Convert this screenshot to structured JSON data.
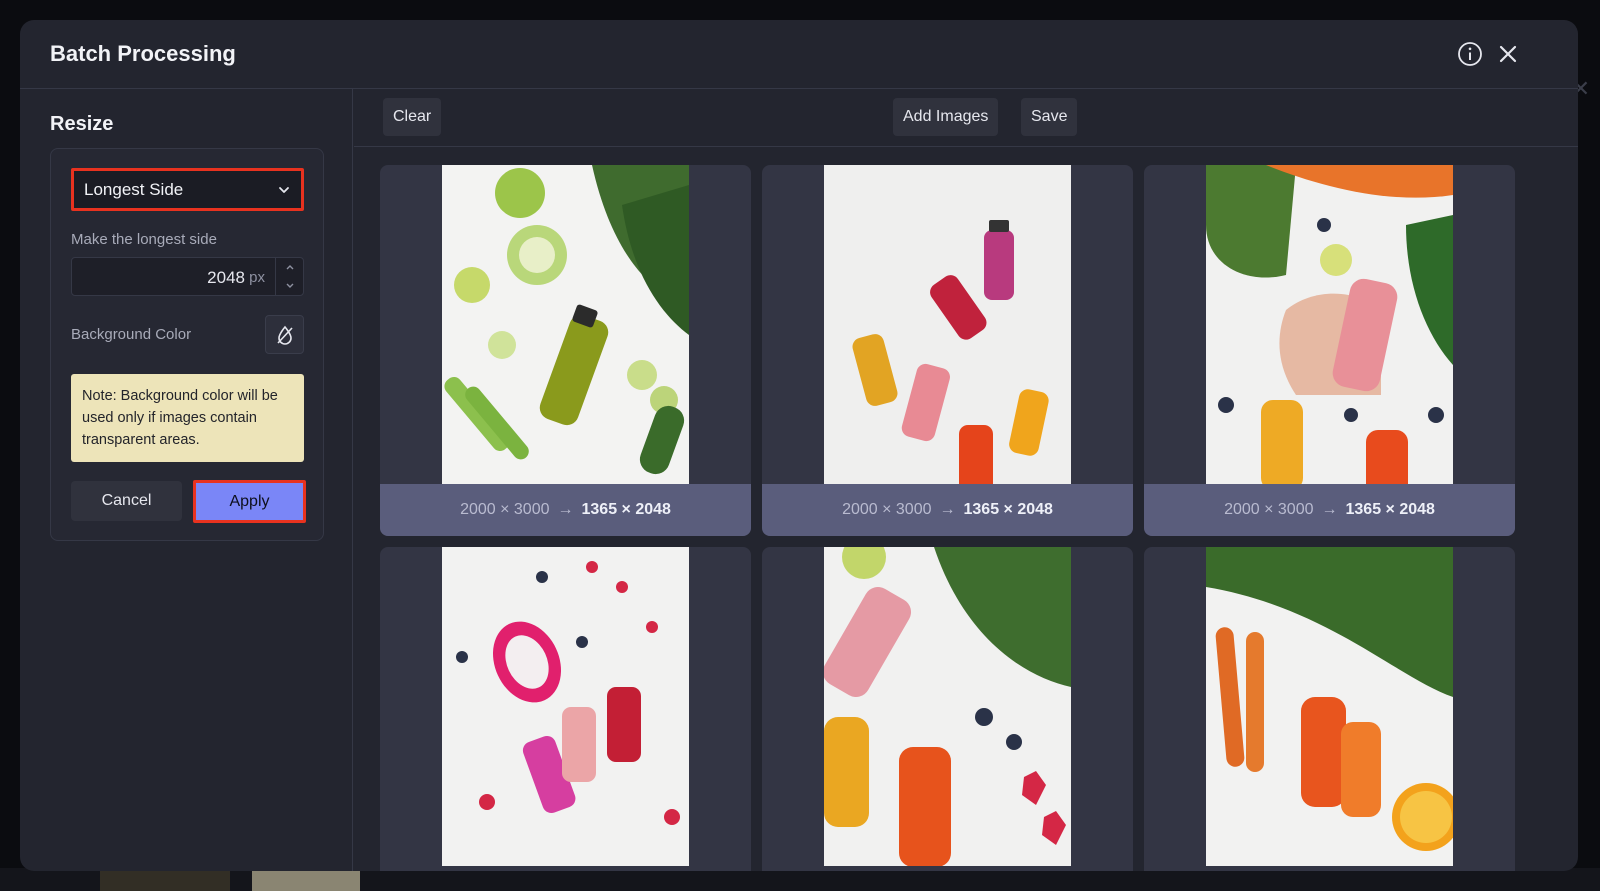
{
  "modal": {
    "title": "Batch Processing"
  },
  "sidebar": {
    "section_title": "Resize",
    "mode_select": {
      "value": "Longest Side"
    },
    "longest_side_label": "Make the longest side",
    "longest_side_value": "2048",
    "longest_side_unit": "px",
    "background_color_label": "Background Color",
    "note": "Note: Background color will be used only if images contain transparent areas.",
    "cancel_label": "Cancel",
    "apply_label": "Apply"
  },
  "toolbar": {
    "clear_label": "Clear",
    "add_images_label": "Add Images",
    "save_label": "Save"
  },
  "images": [
    {
      "from": "2000 × 3000",
      "to": "1365 × 2048"
    },
    {
      "from": "2000 × 3000",
      "to": "1365 × 2048"
    },
    {
      "from": "2000 × 3000",
      "to": "1365 × 2048"
    },
    {
      "from": "",
      "to": ""
    },
    {
      "from": "",
      "to": ""
    },
    {
      "from": "",
      "to": ""
    }
  ],
  "colors": {
    "accent": "#7a86f7",
    "highlight": "#e8321f",
    "note_bg": "#ede4b9"
  }
}
